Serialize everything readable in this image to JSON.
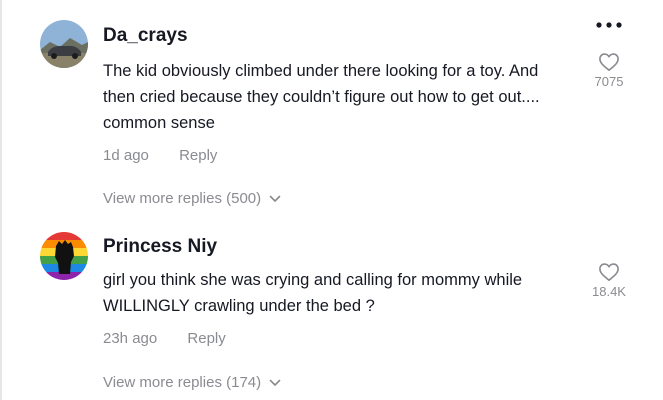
{
  "comments": [
    {
      "username": "Da_crays",
      "text": "The kid obviously climbed under there looking for a toy. And then cried because they couldn’t figure out how to get out.... common sense",
      "time": "1d ago",
      "reply_label": "Reply",
      "likes": "7075",
      "view_more": "View more replies (500)"
    },
    {
      "username": "Princess Niy",
      "text": "girl you think she was crying and calling for mommy while WILLINGLY crawling under the bed ?",
      "time": "23h ago",
      "reply_label": "Reply",
      "likes": "18.4K",
      "view_more": "View more replies (174)"
    }
  ],
  "icons": {
    "more": "more-options-icon",
    "like": "heart-outline-icon",
    "expand": "chevron-down-icon"
  }
}
